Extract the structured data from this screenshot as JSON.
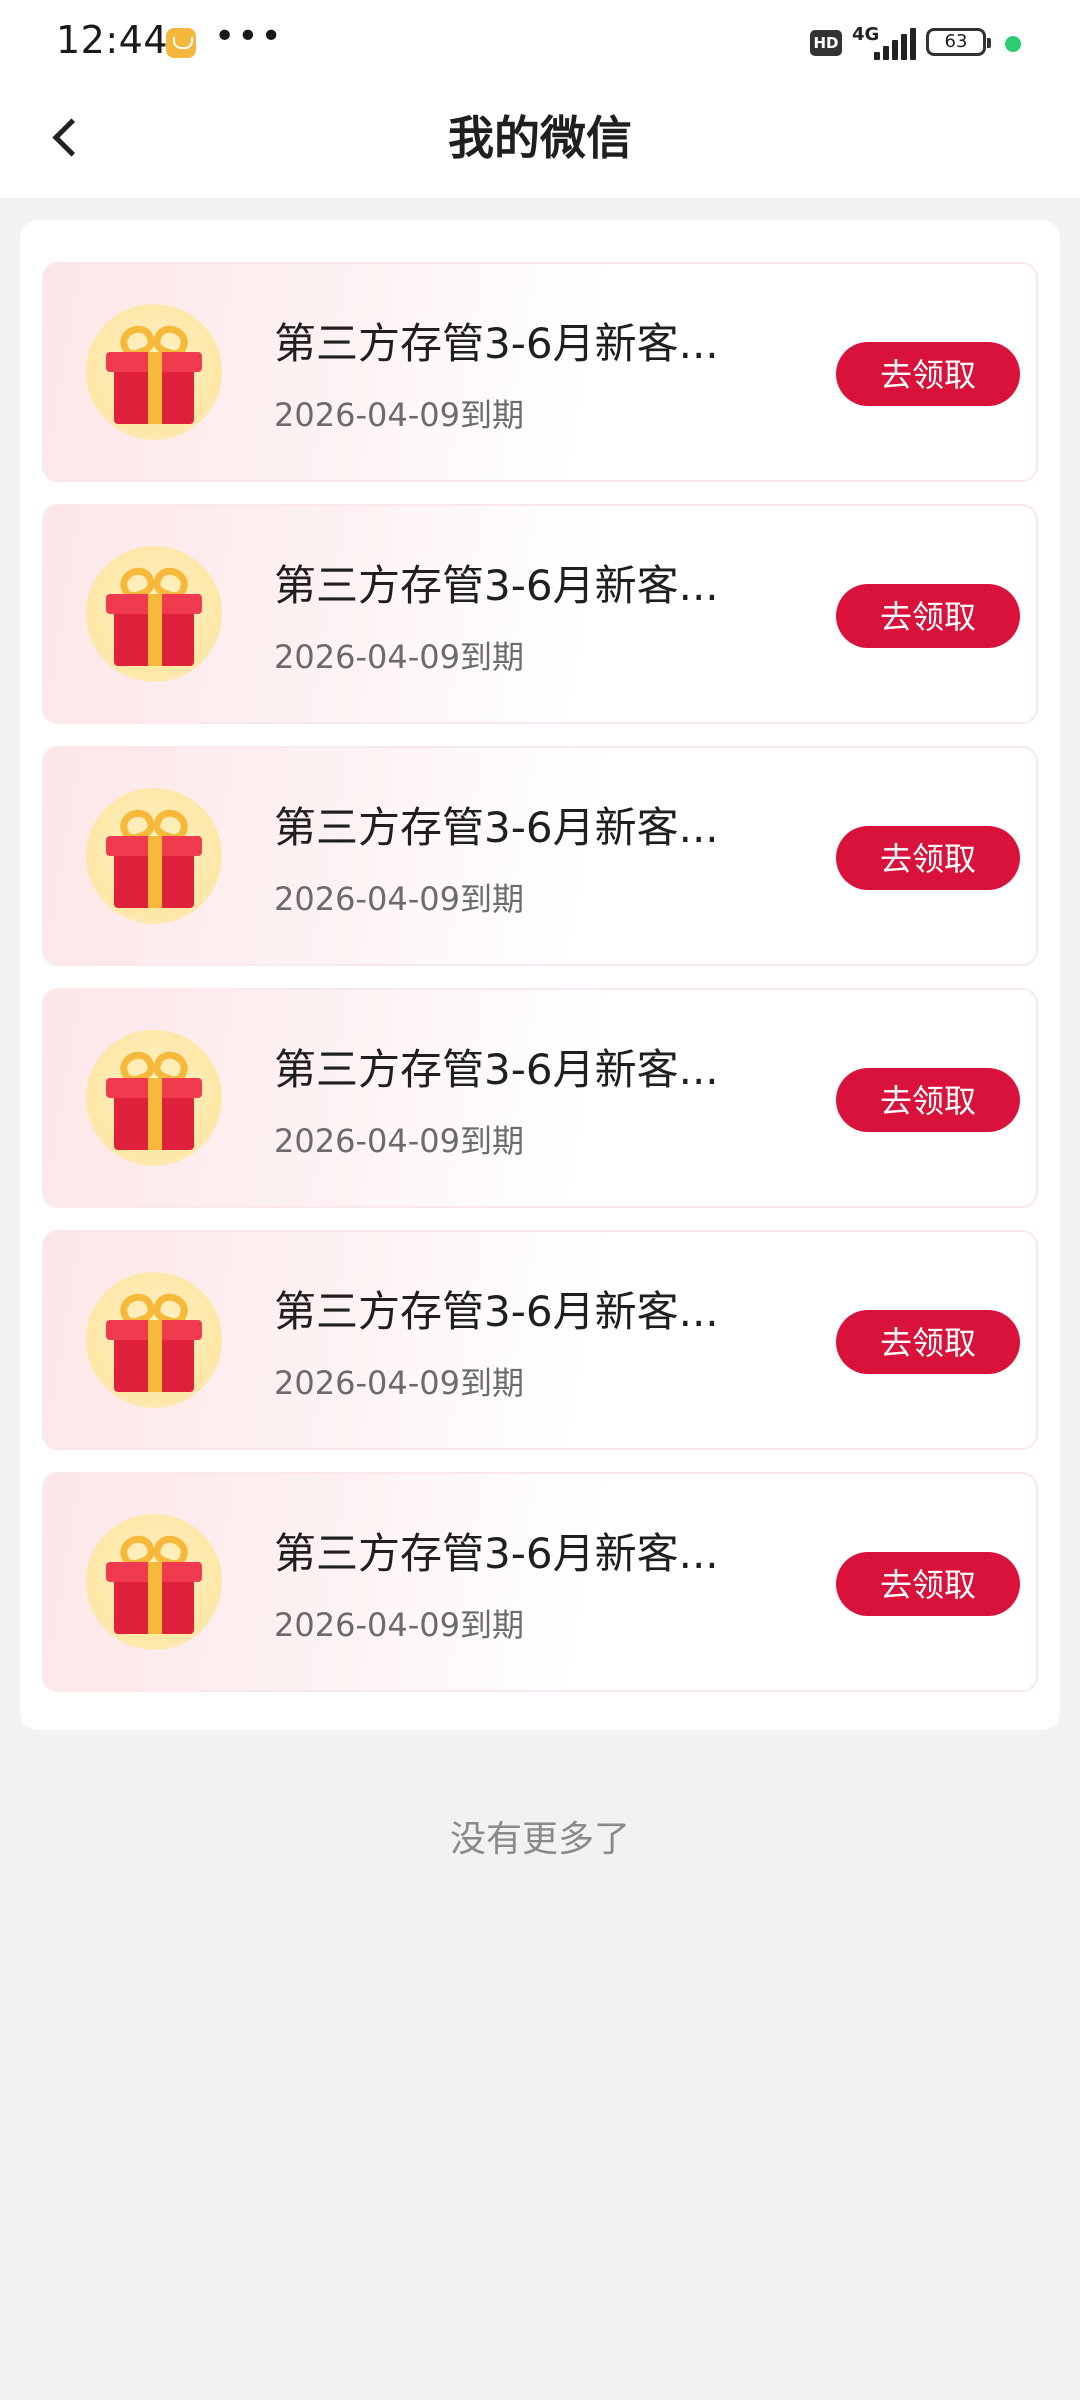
{
  "status_bar": {
    "time": "12:44",
    "more": "•••",
    "hd": "HD",
    "network": "4G",
    "battery": "63"
  },
  "header": {
    "title": "我的微信"
  },
  "coupons": [
    {
      "title": "第三方存管3-6月新客...",
      "expiry": "2026-04-09到期",
      "button": "去领取"
    },
    {
      "title": "第三方存管3-6月新客...",
      "expiry": "2026-04-09到期",
      "button": "去领取"
    },
    {
      "title": "第三方存管3-6月新客...",
      "expiry": "2026-04-09到期",
      "button": "去领取"
    },
    {
      "title": "第三方存管3-6月新客...",
      "expiry": "2026-04-09到期",
      "button": "去领取"
    },
    {
      "title": "第三方存管3-6月新客...",
      "expiry": "2026-04-09到期",
      "button": "去领取"
    },
    {
      "title": "第三方存管3-6月新客...",
      "expiry": "2026-04-09到期",
      "button": "去领取"
    }
  ],
  "footer": {
    "no_more": "没有更多了"
  },
  "colors": {
    "accent": "#d8123a",
    "background": "#f2f2f2"
  }
}
